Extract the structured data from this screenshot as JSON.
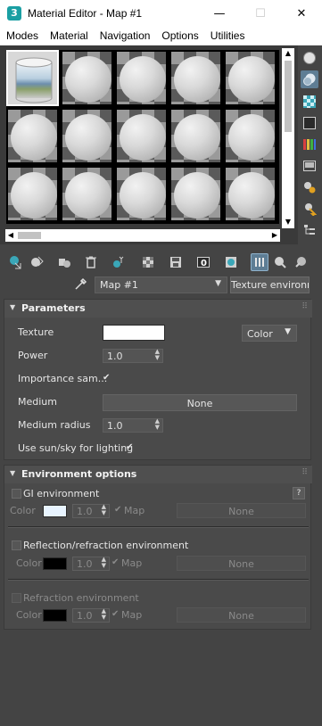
{
  "window": {
    "title": "Material Editor - Map #1",
    "app_icon_text": "3",
    "minimize": "—",
    "maximize": "☐",
    "close": "✕"
  },
  "menu": [
    "Modes",
    "Material",
    "Navigation",
    "Options",
    "Utilities"
  ],
  "sample_slots": {
    "rows": 3,
    "columns": 5,
    "active_slot": 1,
    "scroll_up": "▲",
    "scroll_down": "▼",
    "scroll_left": "◀",
    "scroll_right": "▶"
  },
  "map_selector": {
    "value": "Map #1",
    "caret": "▼",
    "map_type_button": "Texture environment"
  },
  "parameters": {
    "title": "Parameters",
    "texture_label": "Texture",
    "texture_color": "#ffffff",
    "texture_mode": "Color",
    "texture_mode_caret": "▼",
    "power_label": "Power",
    "power_value": "1.0",
    "importance_label": "Importance sam...",
    "importance_checked": "✔",
    "medium_label": "Medium",
    "medium_button": "None",
    "medium_radius_label": "Medium radius",
    "medium_radius_value": "1.0",
    "sunsky_label": "Use sun/sky for lighting",
    "sunsky_checked": "✔"
  },
  "environment_options": {
    "title": "Environment options",
    "gi": {
      "label": "GI environment",
      "help": "?",
      "color_label": "Color",
      "color": "#e8f4ff",
      "value": "1.0",
      "map_check": "✔",
      "map_label": "Map",
      "map_button": "None"
    },
    "reflection": {
      "label": "Reflection/refraction environment",
      "color_label": "Color",
      "color": "#000000",
      "value": "1.0",
      "map_check": "✔",
      "map_label": "Map",
      "map_button": "None"
    },
    "refraction": {
      "label": "Refraction environment",
      "color_label": "Color",
      "color": "#000000",
      "value": "1.0",
      "map_check": "✔",
      "map_label": "Map",
      "map_button": "None"
    }
  },
  "colors": {
    "accent": "#5e7d94",
    "panel": "#4a4a4a",
    "background": "#444444"
  }
}
